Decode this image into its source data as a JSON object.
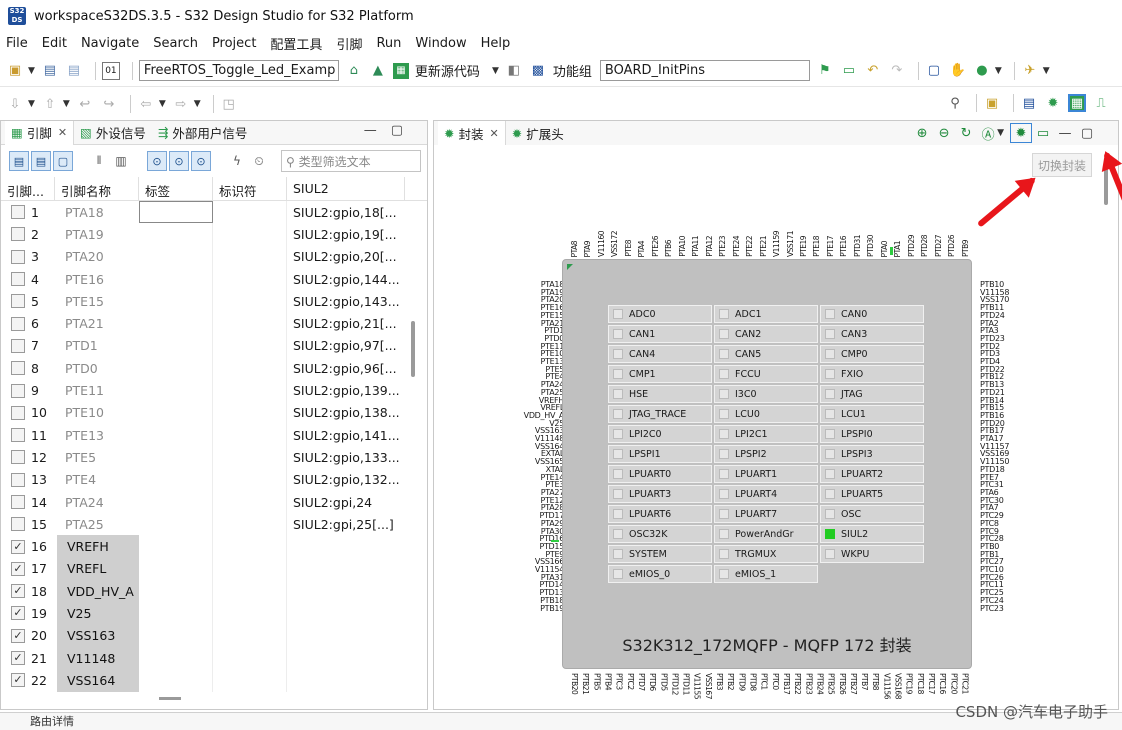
{
  "window": {
    "title": "workspaceS32DS.3.5 - S32 Design Studio for S32 Platform",
    "logo": "S32 DS"
  },
  "menu": [
    "File",
    "Edit",
    "Navigate",
    "Search",
    "Project",
    "配置工具",
    "引脚",
    "Run",
    "Window",
    "Help"
  ],
  "toolbar": {
    "project_combo": "FreeRTOS_Toggle_Led_Examp",
    "update_code": "更新源代码",
    "function_group_label": "功能组",
    "function_group_value": "BOARD_InitPins"
  },
  "left_panel": {
    "tabs": [
      "引脚",
      "外设信号",
      "外部用户信号"
    ],
    "filter_placeholder": "类型筛选文本",
    "columns": [
      "引脚...",
      "引脚名称",
      "标签",
      "标识符",
      "SIUL2"
    ],
    "rows": [
      {
        "num": "1",
        "name": "PTA18",
        "siul2": "SIUL2:gpio,18[...",
        "checked": false
      },
      {
        "num": "2",
        "name": "PTA19",
        "siul2": "SIUL2:gpio,19[...",
        "checked": false
      },
      {
        "num": "3",
        "name": "PTA20",
        "siul2": "SIUL2:gpio,20[...",
        "checked": false
      },
      {
        "num": "4",
        "name": "PTE16",
        "siul2": "SIUL2:gpio,144...",
        "checked": false
      },
      {
        "num": "5",
        "name": "PTE15",
        "siul2": "SIUL2:gpio,143...",
        "checked": false
      },
      {
        "num": "6",
        "name": "PTA21",
        "siul2": "SIUL2:gpio,21[...",
        "checked": false
      },
      {
        "num": "7",
        "name": "PTD1",
        "siul2": "SIUL2:gpio,97[...",
        "checked": false
      },
      {
        "num": "8",
        "name": "PTD0",
        "siul2": "SIUL2:gpio,96[...",
        "checked": false
      },
      {
        "num": "9",
        "name": "PTE11",
        "siul2": "SIUL2:gpio,139...",
        "checked": false
      },
      {
        "num": "10",
        "name": "PTE10",
        "siul2": "SIUL2:gpio,138...",
        "checked": false
      },
      {
        "num": "11",
        "name": "PTE13",
        "siul2": "SIUL2:gpio,141...",
        "checked": false
      },
      {
        "num": "12",
        "name": "PTE5",
        "siul2": "SIUL2:gpio,133...",
        "checked": false
      },
      {
        "num": "13",
        "name": "PTE4",
        "siul2": "SIUL2:gpio,132...",
        "checked": false
      },
      {
        "num": "14",
        "name": "PTA24",
        "siul2": "SIUL2:gpi,24",
        "checked": false
      },
      {
        "num": "15",
        "name": "PTA25",
        "siul2": "SIUL2:gpi,25[...]",
        "checked": false
      },
      {
        "num": "16",
        "name": "VREFH",
        "siul2": "",
        "checked": true
      },
      {
        "num": "17",
        "name": "VREFL",
        "siul2": "",
        "checked": true
      },
      {
        "num": "18",
        "name": "VDD_HV_A",
        "siul2": "",
        "checked": true
      },
      {
        "num": "19",
        "name": "V25",
        "siul2": "",
        "checked": true
      },
      {
        "num": "20",
        "name": "VSS163",
        "siul2": "",
        "checked": true
      },
      {
        "num": "21",
        "name": "V11148",
        "siul2": "",
        "checked": true
      },
      {
        "num": "22",
        "name": "VSS164",
        "siul2": "",
        "checked": true
      }
    ]
  },
  "right_panel": {
    "tabs": [
      "封装",
      "扩展头"
    ],
    "tooltip": "切换封装",
    "package_name": "S32K312_172MQFP - MQFP 172 封装",
    "modules": [
      {
        "label": "ADC0",
        "active": false
      },
      {
        "label": "ADC1",
        "active": false
      },
      {
        "label": "CAN0",
        "active": false
      },
      {
        "label": "CAN1",
        "active": false
      },
      {
        "label": "CAN2",
        "active": false
      },
      {
        "label": "CAN3",
        "active": false
      },
      {
        "label": "CAN4",
        "active": false
      },
      {
        "label": "CAN5",
        "active": false
      },
      {
        "label": "CMP0",
        "active": false
      },
      {
        "label": "CMP1",
        "active": false
      },
      {
        "label": "FCCU",
        "active": false
      },
      {
        "label": "FXIO",
        "active": false
      },
      {
        "label": "HSE",
        "active": false
      },
      {
        "label": "I3C0",
        "active": false
      },
      {
        "label": "JTAG",
        "active": false
      },
      {
        "label": "JTAG_TRACE",
        "active": false
      },
      {
        "label": "LCU0",
        "active": false
      },
      {
        "label": "LCU1",
        "active": false
      },
      {
        "label": "LPI2C0",
        "active": false
      },
      {
        "label": "LPI2C1",
        "active": false
      },
      {
        "label": "LPSPI0",
        "active": false
      },
      {
        "label": "LPSPI1",
        "active": false
      },
      {
        "label": "LPSPI2",
        "active": false
      },
      {
        "label": "LPSPI3",
        "active": false
      },
      {
        "label": "LPUART0",
        "active": false
      },
      {
        "label": "LPUART1",
        "active": false
      },
      {
        "label": "LPUART2",
        "active": false
      },
      {
        "label": "LPUART3",
        "active": false
      },
      {
        "label": "LPUART4",
        "active": false
      },
      {
        "label": "LPUART5",
        "active": false
      },
      {
        "label": "LPUART6",
        "active": false
      },
      {
        "label": "LPUART7",
        "active": false
      },
      {
        "label": "OSC",
        "active": false
      },
      {
        "label": "OSC32K",
        "active": false
      },
      {
        "label": "PowerAndGr",
        "active": false
      },
      {
        "label": "SIUL2",
        "active": true
      },
      {
        "label": "SYSTEM",
        "active": false
      },
      {
        "label": "TRGMUX",
        "active": false
      },
      {
        "label": "WKPU",
        "active": false
      },
      {
        "label": "eMIOS_0",
        "active": false
      },
      {
        "label": "eMIOS_1",
        "active": false
      }
    ],
    "pins_left": [
      "PTA18",
      "PTA19",
      "PTA20",
      "PTE16",
      "PTE15",
      "PTA21",
      "PTD1",
      "PTD0",
      "PTE11",
      "PTE10",
      "PTE13",
      "PTE5",
      "PTE4",
      "PTA24",
      "PTA25",
      "VREFH",
      "VREFL",
      "VDD_HV_A",
      "V25",
      "VSS163",
      "V11148",
      "VSS164",
      "EXTAL",
      "VSS165",
      "XTAL",
      "PTE14",
      "PTE3",
      "PTA27",
      "PTE12",
      "PTA28",
      "PTD17",
      "PTA29",
      "PTA30",
      "PTD16",
      "PTD15",
      "PTE9",
      "VSS166",
      "V11154",
      "PTA31",
      "PTD14",
      "PTD13",
      "PTB18",
      "PTB19"
    ],
    "pins_right": [
      "PTB10",
      "V11158",
      "VSS170",
      "PTB11",
      "PTD24",
      "PTA2",
      "PTA3",
      "PTD23",
      "PTD2",
      "PTD3",
      "PTD4",
      "PTD22",
      "PTB12",
      "PTB13",
      "PTD21",
      "PTB14",
      "PTB15",
      "PTB16",
      "PTD20",
      "PTB17",
      "PTA17",
      "V11157",
      "VSS169",
      "V11150",
      "PTD18",
      "PTE7",
      "PTC31",
      "PTA6",
      "PTC30",
      "PTA7",
      "PTC29",
      "PTC8",
      "PTC9",
      "PTC28",
      "PTB0",
      "PTB1",
      "PTC27",
      "PTC10",
      "PTC26",
      "PTC11",
      "PTC25",
      "PTC24",
      "PTC23"
    ],
    "pins_top": [
      "PTA8",
      "PTA9",
      "V11160",
      "VSS172",
      "PTE8",
      "PTA4",
      "PTE26",
      "PTB6",
      "PTA10",
      "PTA11",
      "PTA12",
      "PTE23",
      "PTE24",
      "PTE22",
      "PTE21",
      "V11159",
      "VSS171",
      "PTE19",
      "PTE18",
      "PTE17",
      "PTE16",
      "PTD31",
      "PTD30",
      "PTA0",
      "PTA1",
      "PTD29",
      "PTD28",
      "PTD27",
      "PTD26",
      "PTB9"
    ],
    "pins_bottom": [
      "PTB20",
      "PTB21",
      "PTB5",
      "PTB4",
      "PTC3",
      "PTC2",
      "PTD7",
      "PTD6",
      "PTD5",
      "PTD12",
      "PTD11",
      "V11155",
      "VSS167",
      "PTB3",
      "PTB2",
      "PTD9",
      "PTD8",
      "PTC1",
      "PTC0",
      "PTB17",
      "PTB22",
      "PTB23",
      "PTB24",
      "PTB25",
      "PTB26",
      "PTB27",
      "PTB7",
      "PTB8",
      "V11156",
      "VSS168",
      "PTC19",
      "PTC18",
      "PTC17",
      "PTC16",
      "PTC20",
      "PTC21"
    ]
  },
  "statusbar": {
    "text": "路由详情"
  },
  "watermark": "CSDN @汽车电子助手",
  "colors": {
    "active_module": "#22cc22",
    "arrow": "#e8161b",
    "chip_body": "#c0c0c0"
  }
}
